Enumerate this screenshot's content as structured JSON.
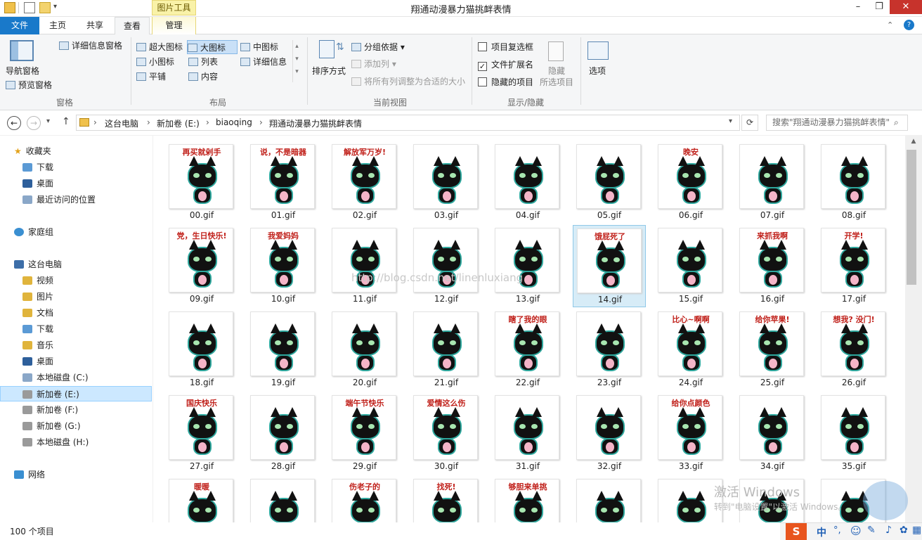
{
  "window": {
    "title": "翔通动漫暴力猫挑衅表情",
    "context_tab": "图片工具"
  },
  "tabs": [
    "文件",
    "主页",
    "共享",
    "查看",
    "管理"
  ],
  "ribbon": {
    "panes": {
      "nav_pane": "导航窗格",
      "preview_pane": "预览窗格",
      "details_pane": "详细信息窗格",
      "group": "窗格"
    },
    "layout": {
      "extra_large": "超大图标",
      "large": "大图标",
      "medium": "中图标",
      "small": "小图标",
      "list": "列表",
      "details": "详细信息",
      "tiles": "平铺",
      "content": "内容",
      "group": "布局"
    },
    "current_view": {
      "sort_by": "排序方式",
      "group_by": "分组依据",
      "add_columns": "添加列",
      "size_all": "将所有列调整为合适的大小",
      "group": "当前视图"
    },
    "show_hide": {
      "item_checkboxes": "项目复选框",
      "file_ext": "文件扩展名",
      "hidden_items": "隐藏的项目",
      "hide_selected": "隐藏",
      "hide_selected_2": "所选项目",
      "group": "显示/隐藏",
      "options": "选项"
    }
  },
  "address": {
    "crumbs": [
      "这台电脑",
      "新加卷 (E:)",
      "biaoqing",
      "翔通动漫暴力猫挑衅表情"
    ],
    "search_placeholder": "搜索\"翔通动漫暴力猫挑衅表情\""
  },
  "nav": {
    "favorites": "收藏夹",
    "fav_items": [
      "下载",
      "桌面",
      "最近访问的位置"
    ],
    "homegroup": "家庭组",
    "this_pc": "这台电脑",
    "pc_items": [
      "视频",
      "图片",
      "文档",
      "下载",
      "音乐",
      "桌面",
      "本地磁盘 (C:)",
      "新加卷 (E:)",
      "新加卷 (F:)",
      "新加卷 (G:)",
      "本地磁盘 (H:)"
    ],
    "network": "网络"
  },
  "files": [
    {
      "name": "00.gif",
      "caption": "再买就剁手"
    },
    {
      "name": "01.gif",
      "caption": "说，不是暗器"
    },
    {
      "name": "02.gif",
      "caption": "解放军万岁!"
    },
    {
      "name": "03.gif",
      "caption": ""
    },
    {
      "name": "04.gif",
      "caption": ""
    },
    {
      "name": "05.gif",
      "caption": ""
    },
    {
      "name": "06.gif",
      "caption": "晚安"
    },
    {
      "name": "07.gif",
      "caption": ""
    },
    {
      "name": "08.gif",
      "caption": ""
    },
    {
      "name": "09.gif",
      "caption": "党，生日快乐!"
    },
    {
      "name": "10.gif",
      "caption": "我爱妈妈"
    },
    {
      "name": "11.gif",
      "caption": ""
    },
    {
      "name": "12.gif",
      "caption": ""
    },
    {
      "name": "13.gif",
      "caption": ""
    },
    {
      "name": "14.gif",
      "caption": "饿屁死了"
    },
    {
      "name": "15.gif",
      "caption": ""
    },
    {
      "name": "16.gif",
      "caption": "来抓我啊"
    },
    {
      "name": "17.gif",
      "caption": "开学!"
    },
    {
      "name": "18.gif",
      "caption": ""
    },
    {
      "name": "19.gif",
      "caption": ""
    },
    {
      "name": "20.gif",
      "caption": ""
    },
    {
      "name": "21.gif",
      "caption": ""
    },
    {
      "name": "22.gif",
      "caption": "瞎了我的眼"
    },
    {
      "name": "23.gif",
      "caption": ""
    },
    {
      "name": "24.gif",
      "caption": "比心~啊啊"
    },
    {
      "name": "25.gif",
      "caption": "给你苹果!"
    },
    {
      "name": "26.gif",
      "caption": "想我? 没门!"
    },
    {
      "name": "27.gif",
      "caption": "国庆快乐"
    },
    {
      "name": "28.gif",
      "caption": ""
    },
    {
      "name": "29.gif",
      "caption": "端午节快乐"
    },
    {
      "name": "30.gif",
      "caption": "爱情这么伤"
    },
    {
      "name": "31.gif",
      "caption": ""
    },
    {
      "name": "32.gif",
      "caption": ""
    },
    {
      "name": "33.gif",
      "caption": "给你点颜色"
    },
    {
      "name": "34.gif",
      "caption": ""
    },
    {
      "name": "35.gif",
      "caption": ""
    },
    {
      "name": "",
      "caption": "暖暖"
    },
    {
      "name": "",
      "caption": ""
    },
    {
      "name": "",
      "caption": "伤老子的"
    },
    {
      "name": "",
      "caption": "找死!"
    },
    {
      "name": "",
      "caption": "够胆来单挑"
    },
    {
      "name": "",
      "caption": ""
    },
    {
      "name": "",
      "caption": ""
    },
    {
      "name": "",
      "caption": ""
    },
    {
      "name": "",
      "caption": ""
    }
  ],
  "selected_file": "14.gif",
  "status": {
    "count": "100 个项目"
  },
  "overlay": {
    "watermark_url": "http://blog.csdn.net/linenluxiang",
    "activate_1": "激活 Windows",
    "activate_2": "转到\"电脑设置\"以激活 Windows。"
  },
  "tray": {
    "ime": "中"
  }
}
